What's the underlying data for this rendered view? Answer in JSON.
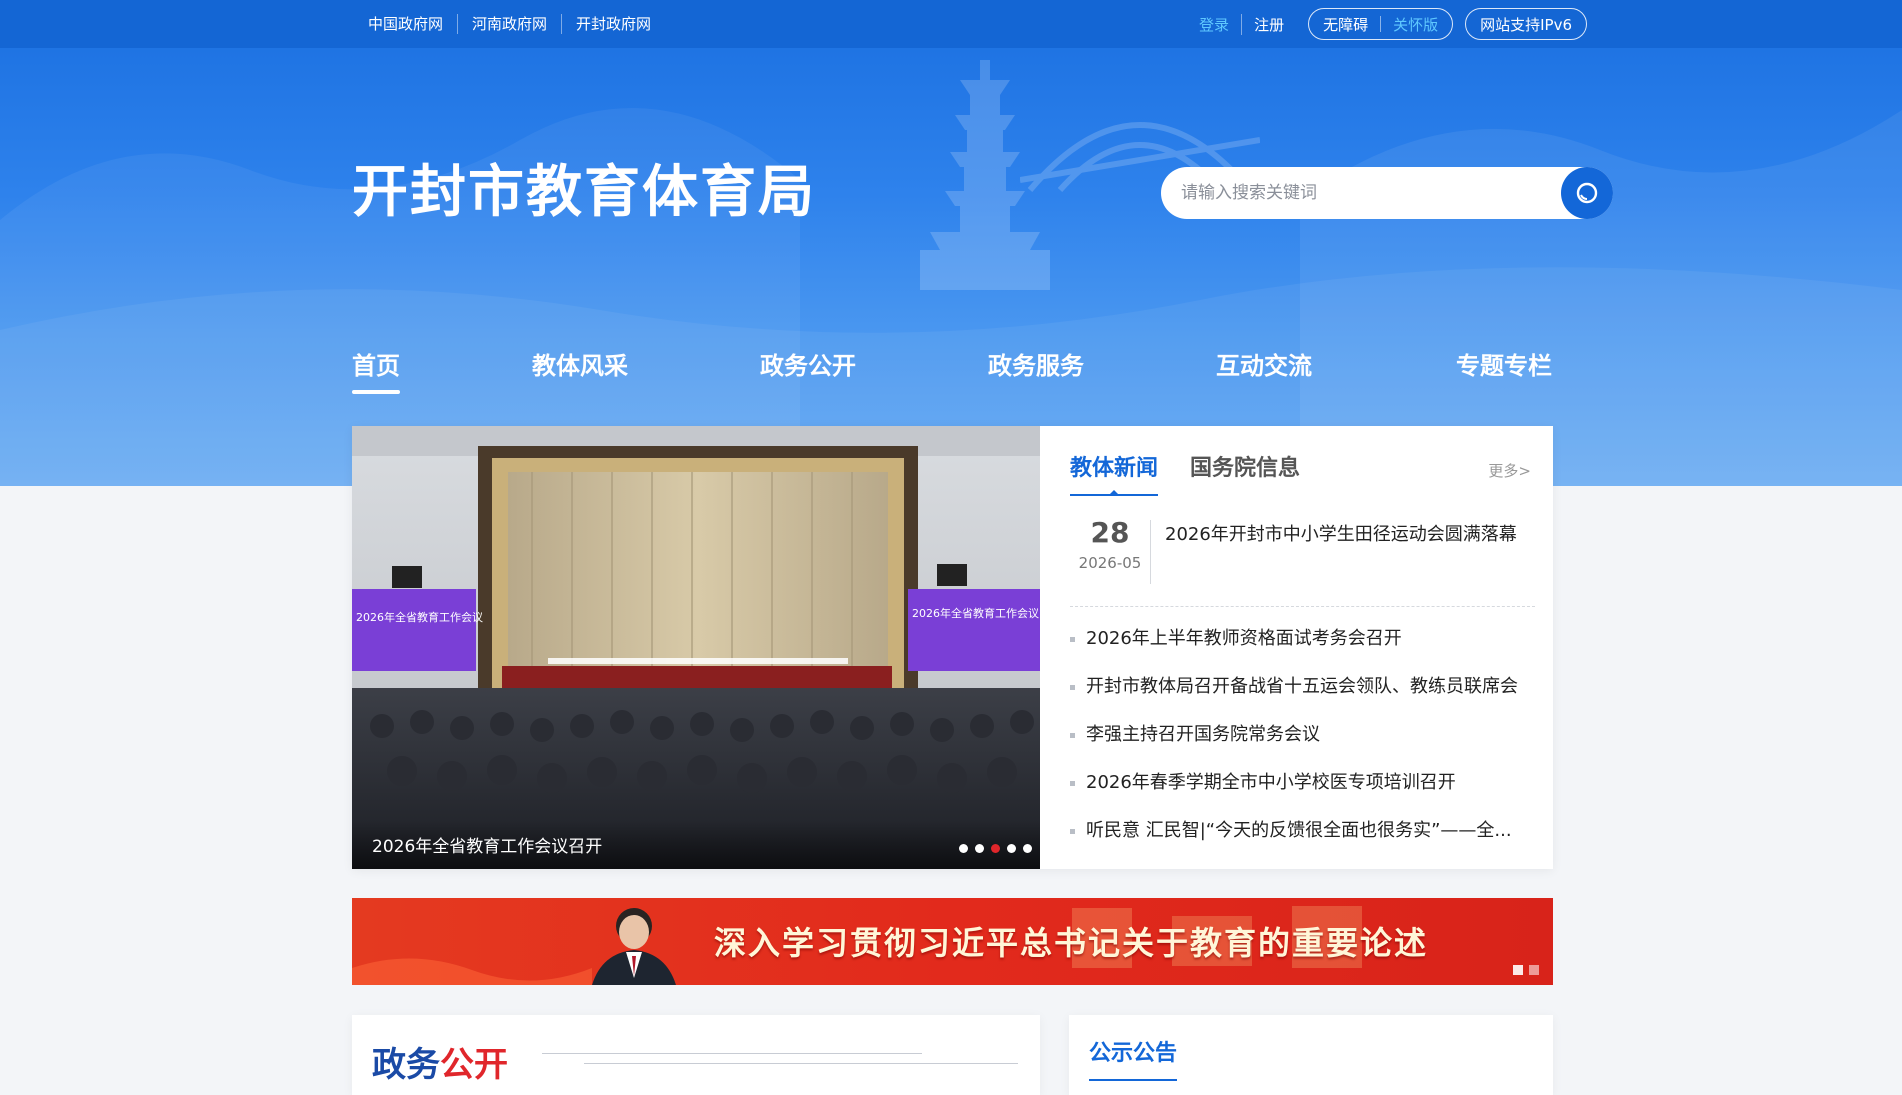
{
  "topbar": {
    "gov_links": [
      "中国政府网",
      "河南政府网",
      "开封政府网"
    ],
    "login": "登录",
    "register": "注册",
    "accessible": "无障碍",
    "care_mode": "关怀版",
    "ipv6": "网站支持IPv6"
  },
  "header": {
    "title": "开封市教育体育局",
    "search_placeholder": "请输入搜索关键词"
  },
  "nav": {
    "items": [
      "首页",
      "教体风采",
      "政务公开",
      "政务服务",
      "互动交流",
      "专题专栏"
    ],
    "active_index": 0
  },
  "slider": {
    "caption": "2026年全省教育工作会议召开",
    "screen_text": "2026年全省教育工作会议",
    "active_dot": 2,
    "dot_count": 5
  },
  "news": {
    "tabs": [
      "教体新闻",
      "国务院信息"
    ],
    "active_tab": 0,
    "more": "更多>",
    "feature": {
      "day": "28",
      "year_month": "2026-05",
      "title": "2026年开封市中小学生田径运动会圆满落幕"
    },
    "items": [
      "2026年上半年教师资格面试考务会召开",
      "开封市教体局召开备战省十五运会领队、教练员联席会",
      "李强主持召开国务院常务会议",
      "2026年春季学期全市中小学校医专项培训召开",
      "听民意 汇民智|“今天的反馈很全面也很务实”——全..."
    ]
  },
  "banner": {
    "text": "深入学习贯彻习近平总书记关于教育的重要论述"
  },
  "sections": {
    "left_title_a": "政务",
    "left_title_b": "公开",
    "right_title": "公示公告"
  },
  "colors": {
    "primary": "#1367d8",
    "accent_red": "#e0262b",
    "banner_red": "#e22a1c"
  }
}
